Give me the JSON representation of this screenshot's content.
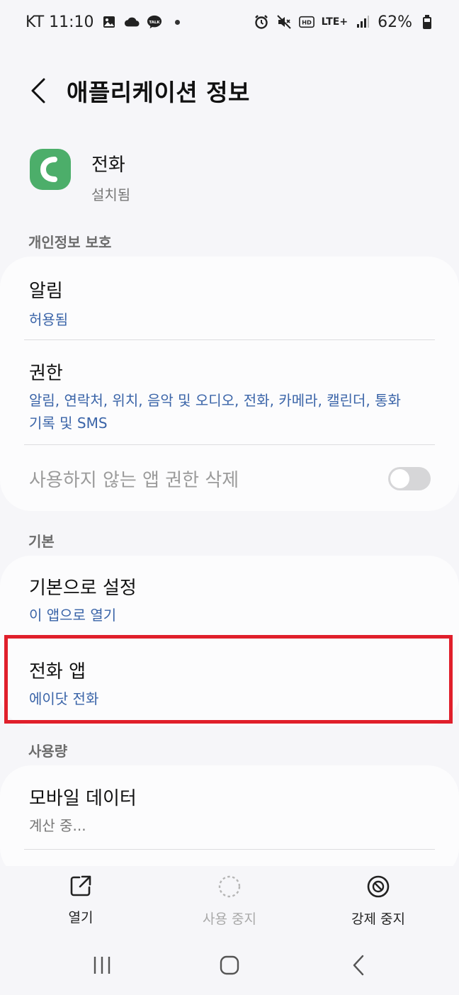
{
  "status_bar": {
    "carrier_time": "KT 11:10",
    "lte": "LTE+",
    "battery": "62%"
  },
  "header": {
    "title": "애플리케이션 정보"
  },
  "app": {
    "name": "전화",
    "status": "설치됨",
    "icon_color": "#4cae6a"
  },
  "sections": {
    "privacy": {
      "label": "개인정보 보호",
      "notifications": {
        "title": "알림",
        "sub": "허용됨"
      },
      "permissions": {
        "title": "권한",
        "sub_line1": "알림, 연락처, 위치, 음악 및 오디오, 전화, 카메라, 캘린더, 통화",
        "sub_line2": "기록 및 SMS"
      },
      "remove_permissions": {
        "label": "사용하지 않는 앱 권한 삭제",
        "enabled": false
      }
    },
    "defaults": {
      "label": "기본",
      "set_default": {
        "title": "기본으로 설정",
        "sub": "이 앱으로 열기"
      },
      "phone_app": {
        "title": "전화 앱",
        "sub": "에이닷 전화"
      }
    },
    "usage": {
      "label": "사용량",
      "mobile_data": {
        "title": "모바일 데이터",
        "sub": "계산 중..."
      }
    }
  },
  "bottom_actions": {
    "open": "열기",
    "disable": "사용 중지",
    "force_stop": "강제 중지"
  },
  "colors": {
    "link_blue": "#3a64a8",
    "highlight_red": "#e01f2b"
  }
}
